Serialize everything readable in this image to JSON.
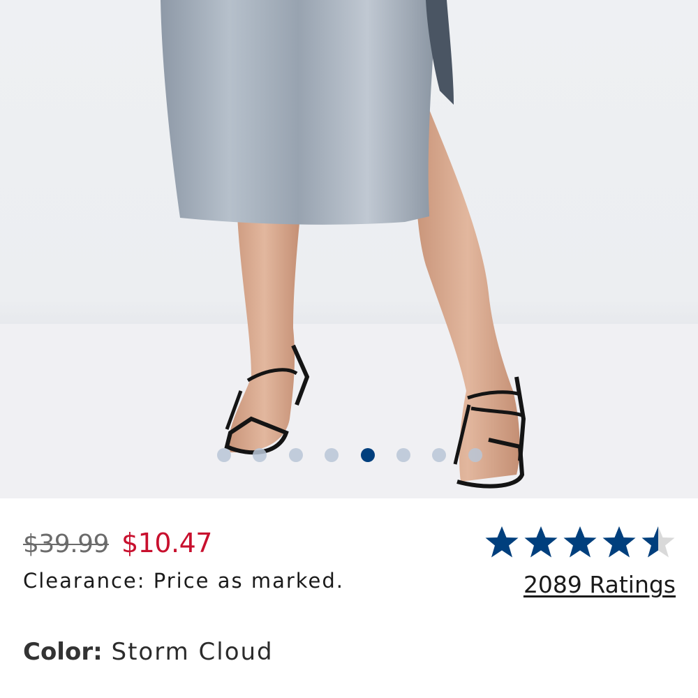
{
  "product": {
    "image_alt": "Model wearing storm cloud satin skirt and black strappy sandals",
    "carousel": {
      "total": 8,
      "active_index": 4
    },
    "price": {
      "original": "$39.99",
      "current": "$10.47"
    },
    "clearance_note": "Clearance: Price as marked.",
    "rating": {
      "stars": 4.5,
      "count_label": "2089 Ratings"
    },
    "color": {
      "label": "Color:",
      "value": "Storm Cloud"
    }
  },
  "colors": {
    "price_sale": "#c8102e",
    "star_fill": "#003f7d",
    "dot_active": "#003f7d",
    "dot_inactive": "#b9c6d6"
  }
}
